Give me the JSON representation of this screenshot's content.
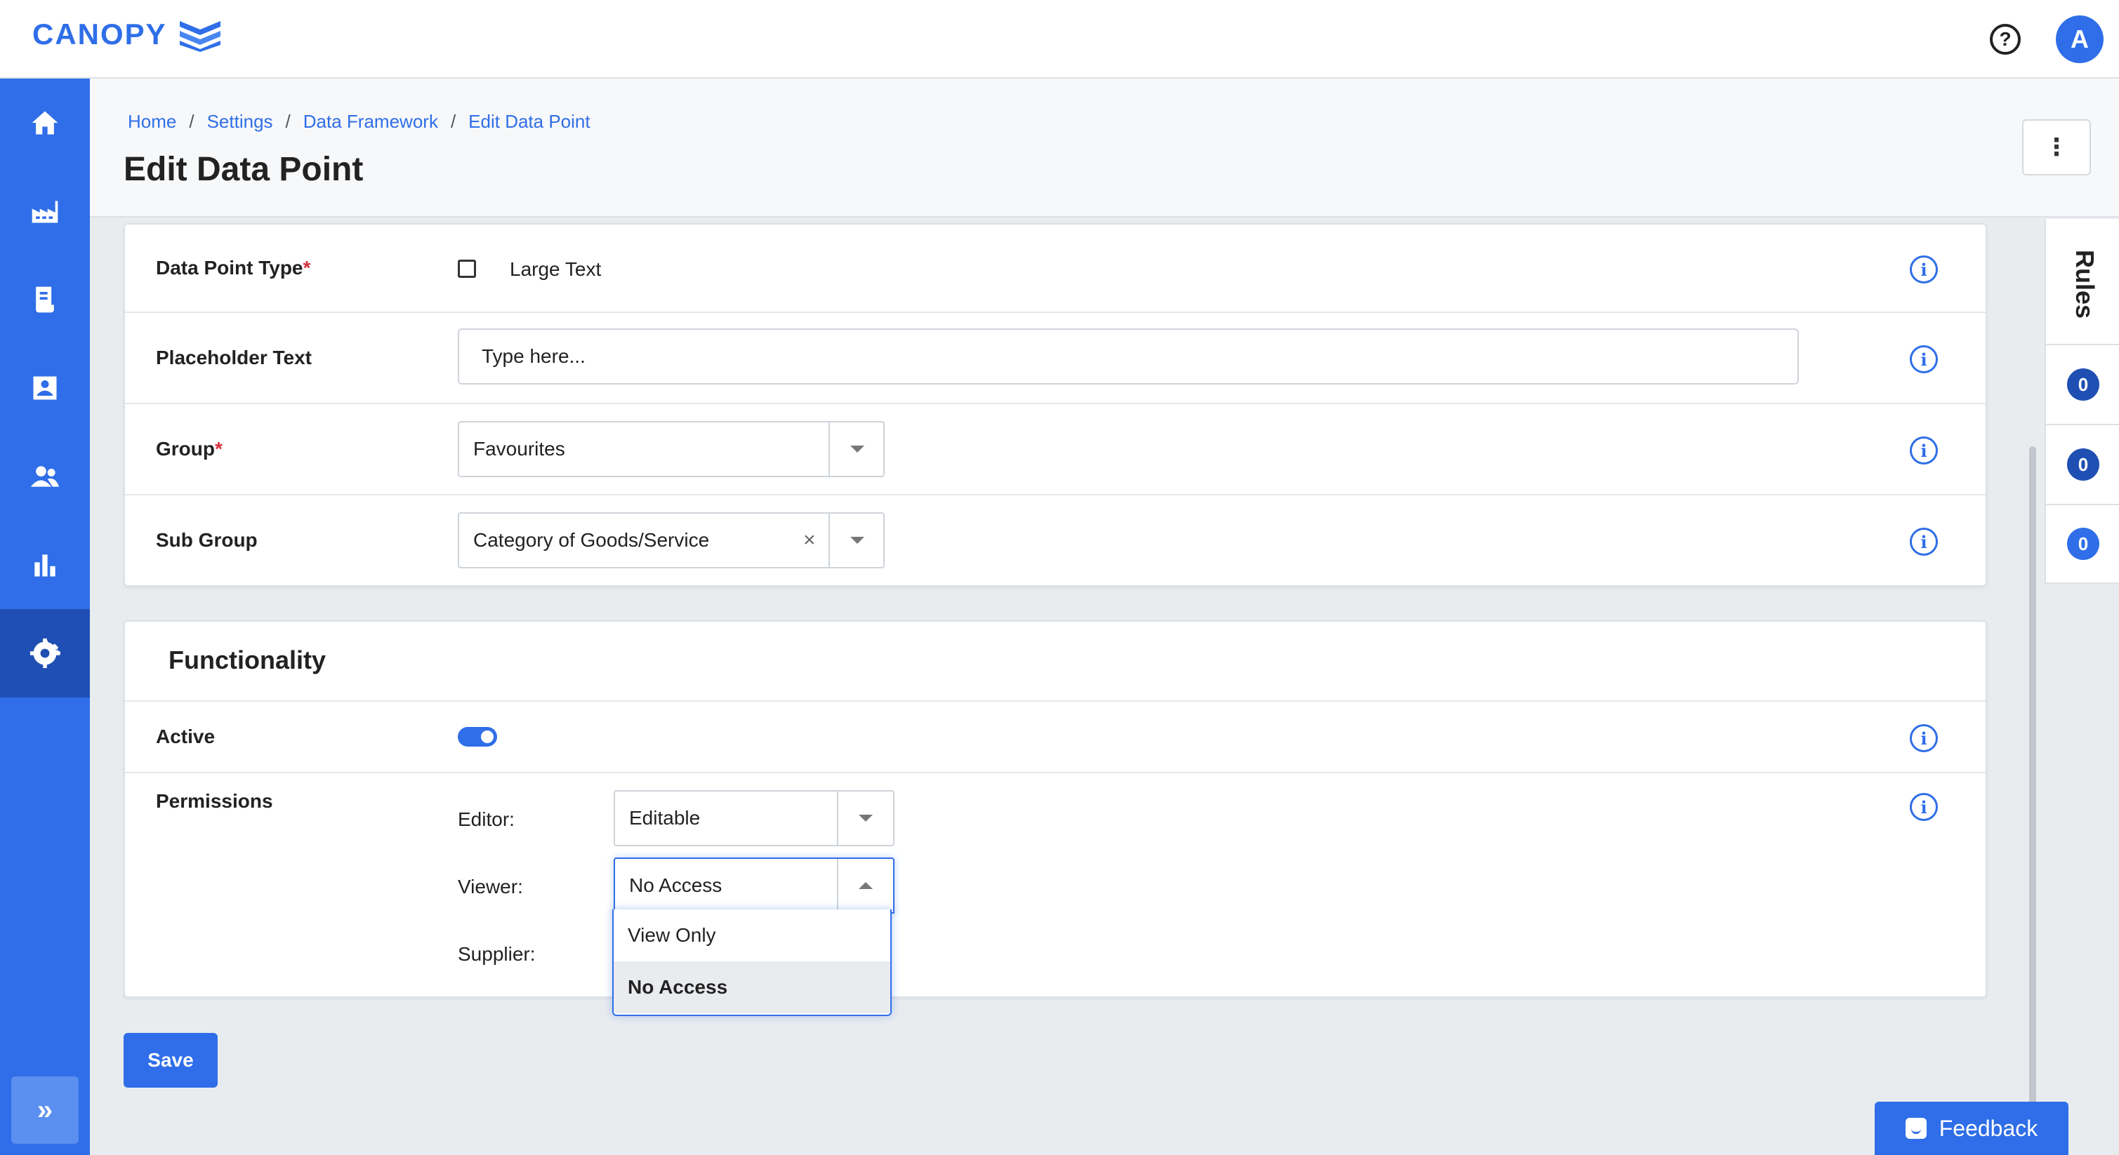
{
  "app": {
    "logo_text": "CANOPY",
    "user_initial": "A",
    "help_glyph": "?"
  },
  "colors": {
    "accent": "#2f6ee8",
    "sidebar_active": "#1f4fb3",
    "required": "#d6303a",
    "rule_badge_dark": "#1f4fb3"
  },
  "sidebar": {
    "items": [
      {
        "icon": "home-icon"
      },
      {
        "icon": "factory-icon"
      },
      {
        "icon": "document-icon"
      },
      {
        "icon": "contact-card-icon"
      },
      {
        "icon": "users-icon"
      },
      {
        "icon": "bar-chart-icon"
      },
      {
        "icon": "gear-icon",
        "active": true
      }
    ],
    "expand_glyph": "»"
  },
  "header": {
    "breadcrumb": [
      "Home",
      "Settings",
      "Data Framework",
      "Edit Data Point"
    ],
    "breadcrumb_sep": "/",
    "title": "Edit Data Point",
    "kebab_glyph": "⋮"
  },
  "details": {
    "data_point_type": {
      "label": "Data Point Type",
      "required_mark": "*",
      "value": "Large Text"
    },
    "placeholder_text": {
      "label": "Placeholder Text",
      "value": "Type here..."
    },
    "group": {
      "label": "Group",
      "required_mark": "*",
      "value": "Favourites"
    },
    "sub_group": {
      "label": "Sub Group",
      "value": "Category of Goods/Service",
      "clear_glyph": "×"
    }
  },
  "functionality": {
    "title": "Functionality",
    "active": {
      "label": "Active",
      "on": true
    },
    "permissions": {
      "label": "Permissions",
      "editor": {
        "label": "Editor:",
        "value": "Editable"
      },
      "viewer": {
        "label": "Viewer:",
        "value": "No Access"
      },
      "supplier": {
        "label": "Supplier:"
      },
      "options": [
        "View Only",
        "No Access"
      ]
    }
  },
  "info_glyph": "i",
  "save_label": "Save",
  "rules": {
    "title": "Rules",
    "counts": [
      "0",
      "0",
      "0"
    ]
  },
  "feedback_label": "Feedback"
}
